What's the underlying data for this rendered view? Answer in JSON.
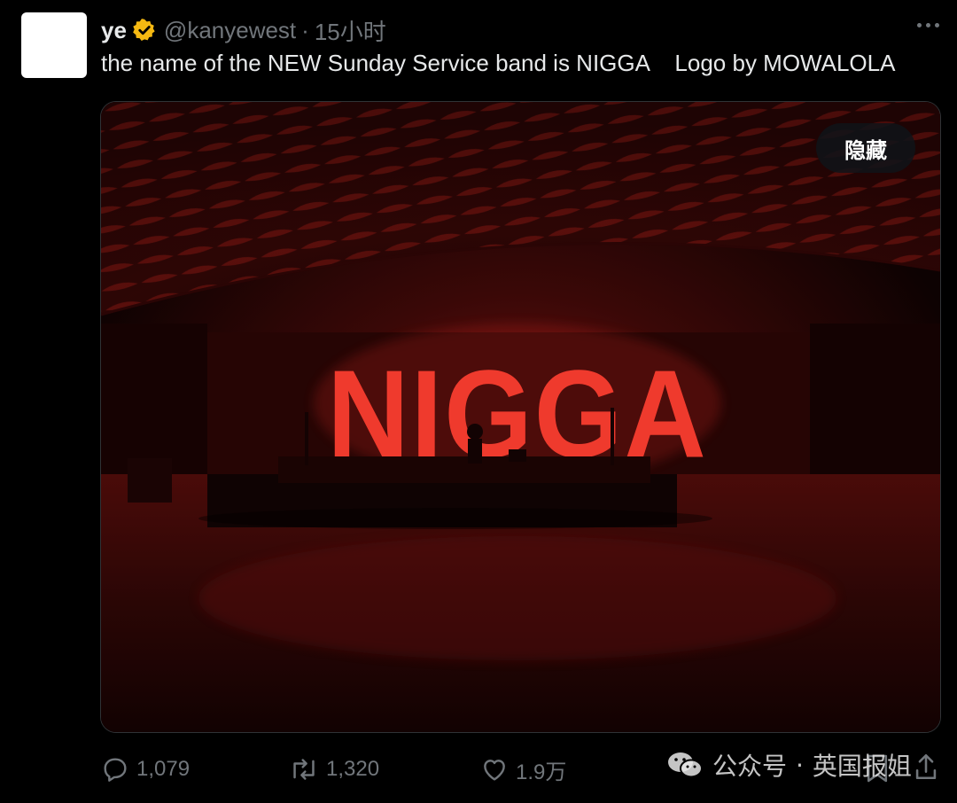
{
  "tweet": {
    "author_name": "ye",
    "handle": "@kanyewest",
    "separator": "·",
    "time": "15小时",
    "text": "the name of the NEW Sunday Service band is NIGGA    Logo by MOWALOLA",
    "verified_color": "#f5b912"
  },
  "media": {
    "sign_text": "NIGGA",
    "hide_label": "隐藏",
    "accent_color": "#e8322a"
  },
  "actions": {
    "replies": "1,079",
    "retweets": "1,320",
    "likes": "1.9万"
  },
  "watermark": {
    "label": "公众号",
    "separator": "·",
    "account": "英国报姐"
  }
}
